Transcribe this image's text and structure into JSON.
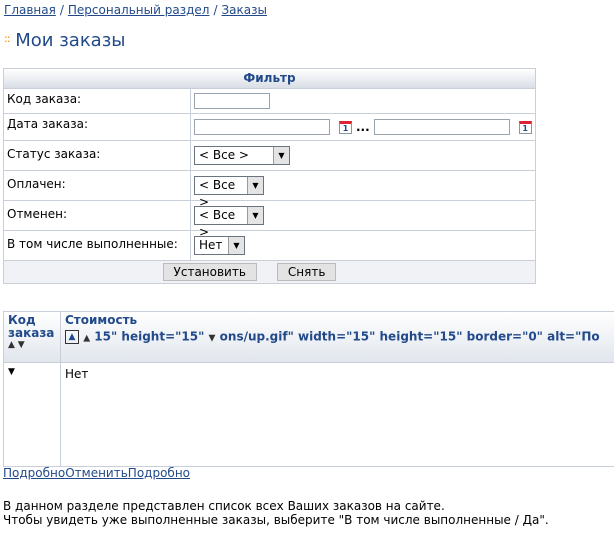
{
  "breadcrumb": {
    "home": "Главная",
    "personal": "Персональный раздел",
    "orders": "Заказы",
    "sep": "/"
  },
  "page": {
    "title": "Мои заказы",
    "title_dots": "::"
  },
  "filter": {
    "header": "Фильтр",
    "order_code_label": "Код заказа:",
    "order_date_label": "Дата заказа:",
    "date_sep": "...",
    "calendar_glyph": "1",
    "status_label": "Статус заказа:",
    "status_value": "< Все >",
    "paid_label": "Оплачен:",
    "paid_value": "< Все >",
    "cancelled_label": "Отменен:",
    "cancelled_value": "< Все >",
    "completed_label": "В том числе выполненные:",
    "completed_value": "Нет",
    "apply_button": "Установить",
    "reset_button": "Снять"
  },
  "grid": {
    "col1_header": "Код заказа",
    "col2_header": "Стоимость",
    "col2_broken_text": "15\" height=\"15\"",
    "col2_broken_text2": "ons/up.gif\" width=\"15\" height=\"15\" border=\"0\" alt=\"По",
    "row1_value": "Нет"
  },
  "footer_links": {
    "more1": "Подробно",
    "cancel": "Отменить",
    "more2": "Подробно"
  },
  "notes": {
    "line1": "В данном разделе представлен список всех Ваших заказов на сайте.",
    "line2": "Чтобы увидеть уже выполненные заказы, выберите \"В том числе выполненные / Да\"."
  }
}
